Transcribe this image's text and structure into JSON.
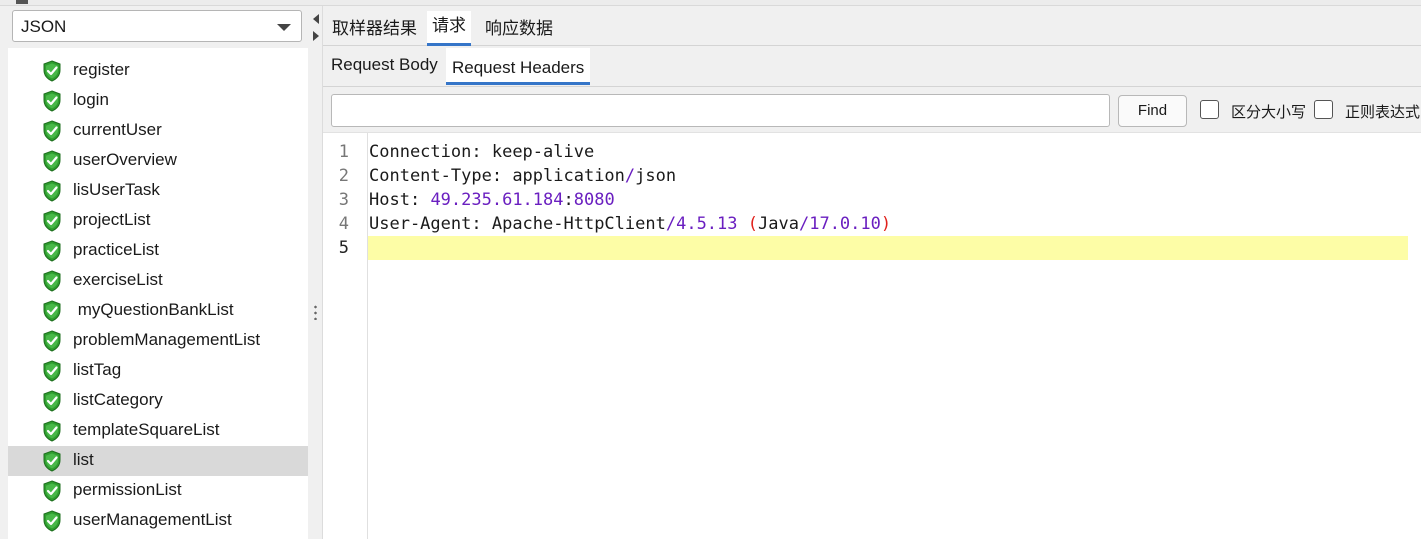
{
  "sampler_type": "JSON",
  "tree": {
    "items": [
      {
        "label": "register"
      },
      {
        "label": "login"
      },
      {
        "label": "currentUser"
      },
      {
        "label": "userOverview"
      },
      {
        "label": "lisUserTask"
      },
      {
        "label": "projectList"
      },
      {
        "label": "practiceList"
      },
      {
        "label": "exerciseList"
      },
      {
        "label": " myQuestionBankList"
      },
      {
        "label": "problemManagementList"
      },
      {
        "label": "listTag"
      },
      {
        "label": "listCategory"
      },
      {
        "label": "templateSquareList"
      },
      {
        "label": "list",
        "selected": true
      },
      {
        "label": "permissionList"
      },
      {
        "label": "userManagementList"
      }
    ]
  },
  "result_tabs": {
    "sampler_result": "取样器结果",
    "request": "请求",
    "response_data": "响应数据",
    "active": "request"
  },
  "request_tabs": {
    "body": "Request Body",
    "headers": "Request Headers",
    "active": "headers"
  },
  "search": {
    "value": "",
    "placeholder": "",
    "find_label": "Find",
    "case_sensitive_label": "区分大小写",
    "case_sensitive": false,
    "regex_label": "正则表达式",
    "regex": false
  },
  "editor": {
    "current_line": 5,
    "lines": [
      {
        "n": "1",
        "tokens": [
          {
            "t": "Connection",
            "k": "key"
          },
          {
            "t": ": ",
            "k": "punct"
          },
          {
            "t": "keep-alive",
            "k": "text"
          }
        ]
      },
      {
        "n": "2",
        "tokens": [
          {
            "t": "Content-Type",
            "k": "key"
          },
          {
            "t": ": ",
            "k": "punct"
          },
          {
            "t": "application",
            "k": "text"
          },
          {
            "t": "/",
            "k": "num"
          },
          {
            "t": "json",
            "k": "text"
          }
        ]
      },
      {
        "n": "3",
        "tokens": [
          {
            "t": "Host",
            "k": "key"
          },
          {
            "t": ": ",
            "k": "punct"
          },
          {
            "t": "49.235.61.184",
            "k": "num"
          },
          {
            "t": ":",
            "k": "punct"
          },
          {
            "t": "8080",
            "k": "num"
          }
        ]
      },
      {
        "n": "4",
        "tokens": [
          {
            "t": "User-Agent",
            "k": "key"
          },
          {
            "t": ": ",
            "k": "punct"
          },
          {
            "t": "Apache-HttpClient",
            "k": "text"
          },
          {
            "t": "/",
            "k": "num"
          },
          {
            "t": "4.5.13",
            "k": "num"
          },
          {
            "t": " ",
            "k": "text"
          },
          {
            "t": "(",
            "k": "paren"
          },
          {
            "t": "Java",
            "k": "text"
          },
          {
            "t": "/",
            "k": "num"
          },
          {
            "t": "17.0.10",
            "k": "num"
          },
          {
            "t": ")",
            "k": "paren"
          }
        ]
      },
      {
        "n": "5",
        "tokens": []
      }
    ]
  },
  "colors": {
    "accent_tab_underline": "#3575c8",
    "current_line_highlight": "#fdfda6",
    "number_token": "#6a1fc0",
    "paren_token": "#e0211b",
    "shield_green": "#2f9e2f"
  },
  "icons": {
    "tree_item": "green-shield-check-icon",
    "combo_arrow": "chevron-down-icon"
  }
}
